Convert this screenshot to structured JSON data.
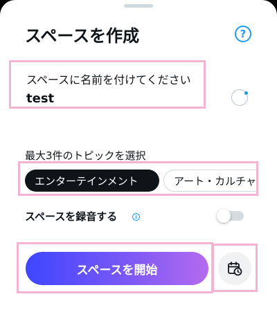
{
  "header": {
    "title": "スペースを作成",
    "help_icon": "question-circle-icon",
    "help_glyph": "?"
  },
  "name_field": {
    "label": "スペースに名前を付けてください",
    "value": "test"
  },
  "loading_icon": "spinner-icon",
  "topics": {
    "label": "最大3件のトピックを選択",
    "chips": [
      {
        "label": "エンターテインメント",
        "selected": true
      },
      {
        "label": "アート・カルチャー",
        "selected": false
      }
    ]
  },
  "recording": {
    "label": "スペースを録音する",
    "info_icon": "info-icon",
    "info_glyph": "i",
    "enabled": false
  },
  "actions": {
    "start_label": "スペースを開始",
    "schedule_icon": "calendar-clock-icon"
  },
  "colors": {
    "accent": "#1d9bf0",
    "start_gradient_from": "#3f46ff",
    "start_gradient_to": "#b46af0",
    "highlight_outline": "#f4b3d0"
  }
}
